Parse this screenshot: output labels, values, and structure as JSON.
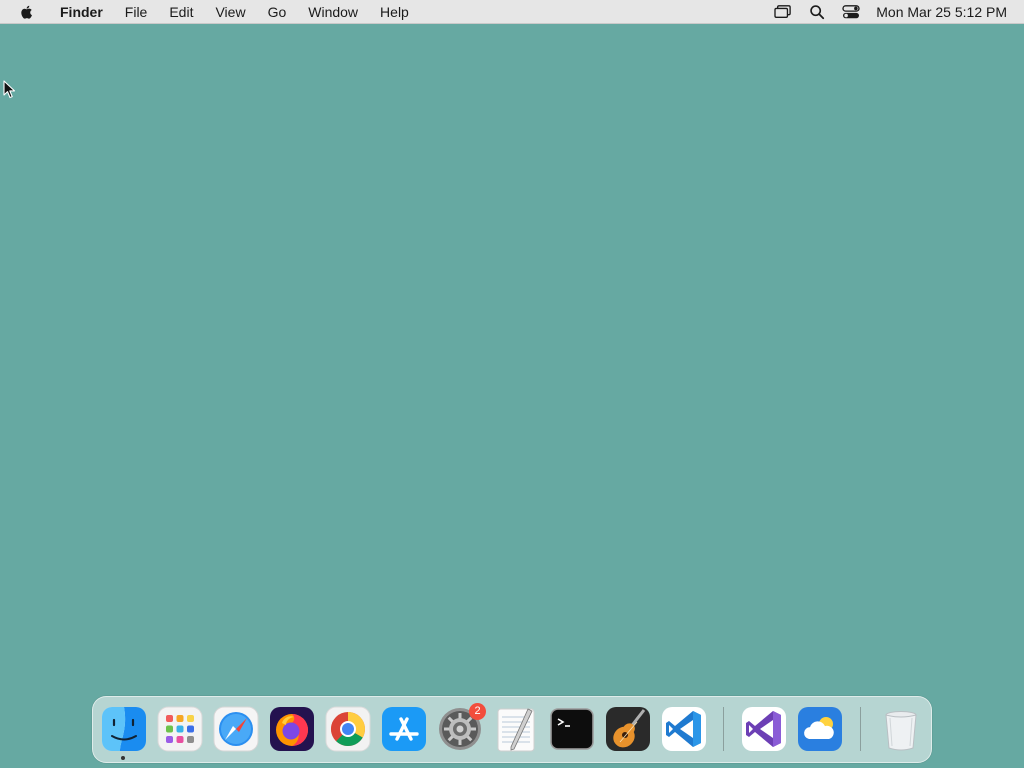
{
  "menubar": {
    "app_name": "Finder",
    "items": [
      "File",
      "Edit",
      "View",
      "Go",
      "Window",
      "Help"
    ],
    "clock": "Mon Mar 25  5:12 PM",
    "status_icons": [
      "screen-mirroring-icon",
      "spotlight-search-icon",
      "control-center-icon"
    ]
  },
  "desktop": {
    "background_color": "#66a9a2"
  },
  "dock": {
    "apps": [
      "finder",
      "launchpad",
      "safari",
      "firefox",
      "chrome",
      "app-store",
      "system-preferences",
      "textedit",
      "terminal",
      "garageband",
      "vscode",
      "visual-studio",
      "weather",
      "trash"
    ],
    "settings_badge": "2"
  }
}
